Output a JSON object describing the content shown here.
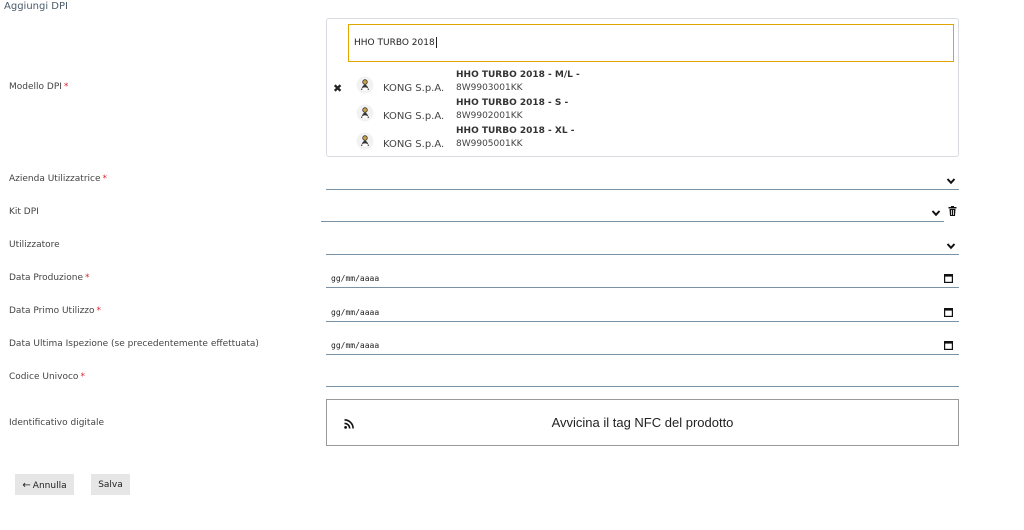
{
  "page_title": "Aggiungi DPI",
  "required_mark": "*",
  "labels": {
    "modello": "Modello DPI",
    "azienda": "Azienda Utilizzatrice",
    "kit": "Kit DPI",
    "utilizzatore": "Utilizzatore",
    "data_produzione": "Data Produzione",
    "data_primo": "Data Primo Utilizzo",
    "data_ultima": "Data Ultima Ispezione (se precedentemente effettuata)",
    "codice": "Codice Univoco",
    "identificativo": "Identificativo digitale"
  },
  "model_search": {
    "value": "HHO TURBO 2018",
    "clear_icon": "close-icon"
  },
  "model_options": [
    {
      "brand": "KONG S.p.A.",
      "name": "HHO TURBO 2018 - M/L -",
      "code": "8W9903001KK"
    },
    {
      "brand": "KONG S.p.A.",
      "name": "HHO TURBO 2018 - S -",
      "code": "8W9902001KK"
    },
    {
      "brand": "KONG S.p.A.",
      "name": "HHO TURBO 2018 - XL -",
      "code": "8W9905001KK"
    }
  ],
  "date_placeholder": "gg/mm/aaaa",
  "nfc": {
    "text": "Avvicina il tag NFC del prodotto",
    "icon": "rss-icon"
  },
  "buttons": {
    "cancel": "Annulla",
    "cancel_icon": "←",
    "save": "Salva"
  },
  "colors": {
    "required": "#d9262b",
    "search_border": "#e0a500",
    "field_underline": "#7a92a8",
    "button_bg": "#e6e6e6"
  }
}
